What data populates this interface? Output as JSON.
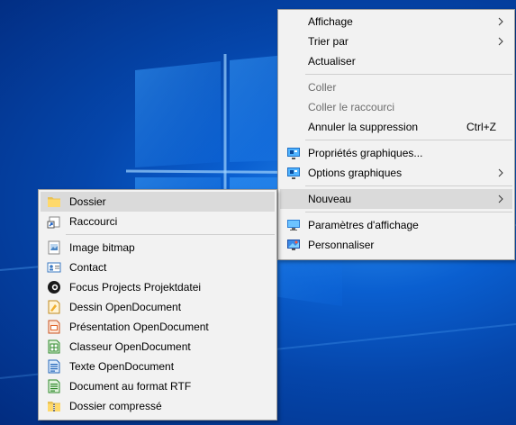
{
  "desktop": {
    "accent": "#0a5fd0"
  },
  "main_menu": {
    "group1": [
      {
        "label": "Affichage",
        "submenu": true
      },
      {
        "label": "Trier par",
        "submenu": true
      },
      {
        "label": "Actualiser"
      }
    ],
    "group2": [
      {
        "label": "Coller",
        "disabled": true
      },
      {
        "label": "Coller le raccourci",
        "disabled": true
      },
      {
        "label": "Annuler la suppression",
        "shortcut": "Ctrl+Z"
      }
    ],
    "group3": [
      {
        "label": "Propriétés graphiques...",
        "icon": "graphics-properties-icon"
      },
      {
        "label": "Options graphiques",
        "icon": "graphics-options-icon",
        "submenu": true
      }
    ],
    "group4": [
      {
        "label": "Nouveau",
        "submenu": true,
        "highlighted": true
      }
    ],
    "group5": [
      {
        "label": "Paramètres d'affichage",
        "icon": "display-settings-icon"
      },
      {
        "label": "Personnaliser",
        "icon": "personalize-icon"
      }
    ]
  },
  "new_submenu": {
    "group1": [
      {
        "label": "Dossier",
        "icon": "folder-icon",
        "highlighted": true
      },
      {
        "label": "Raccourci",
        "icon": "shortcut-icon"
      }
    ],
    "group2": [
      {
        "label": "Image bitmap",
        "icon": "bitmap-icon"
      },
      {
        "label": "Contact",
        "icon": "contact-icon"
      },
      {
        "label": "Focus Projects Projektdatei",
        "icon": "focus-projects-icon"
      },
      {
        "label": "Dessin OpenDocument",
        "icon": "opendocument-drawing-icon"
      },
      {
        "label": "Présentation OpenDocument",
        "icon": "opendocument-presentation-icon"
      },
      {
        "label": "Classeur OpenDocument",
        "icon": "opendocument-spreadsheet-icon"
      },
      {
        "label": "Texte OpenDocument",
        "icon": "opendocument-text-icon"
      },
      {
        "label": "Document au format RTF",
        "icon": "rtf-document-icon"
      },
      {
        "label": "Dossier compressé",
        "icon": "zip-folder-icon"
      }
    ]
  }
}
